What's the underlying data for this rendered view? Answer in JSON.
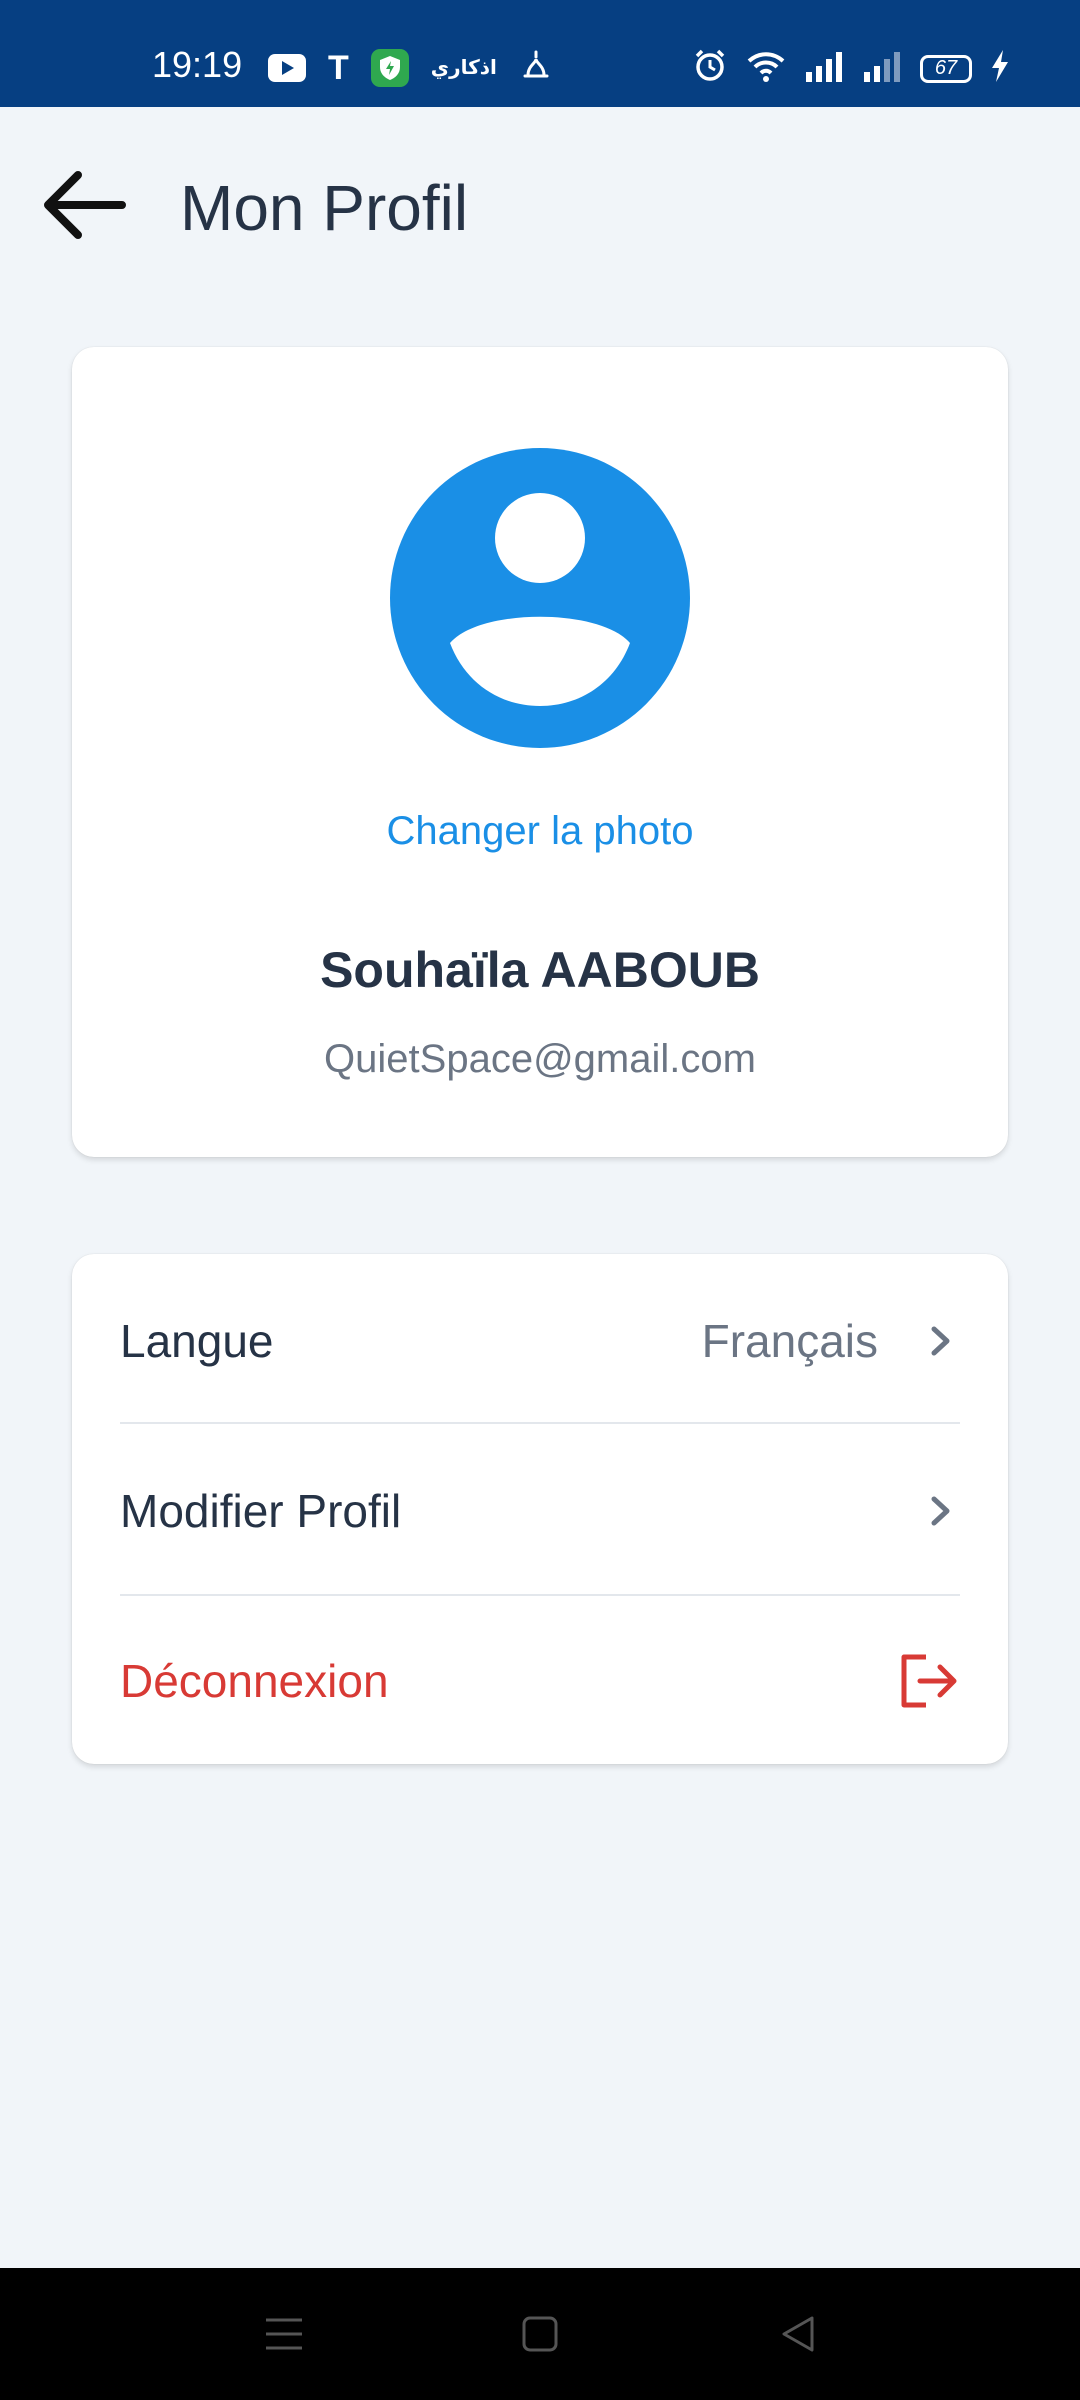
{
  "status_bar": {
    "time": "19:19",
    "app_text": "اذكاري",
    "t_letter": "T",
    "battery": "67",
    "icons": [
      "youtube-icon",
      "t-app-icon",
      "shield-app-icon",
      "azkari-app-icon",
      "mosque-icon",
      "alarm-icon",
      "wifi-icon",
      "signal-icon",
      "signal-2-icon",
      "battery-icon",
      "charging-icon"
    ]
  },
  "header": {
    "title": "Mon Profil",
    "back_icon": "arrow-left-icon"
  },
  "profile": {
    "avatar_icon": "user-avatar-icon",
    "change_photo": "Changer la photo",
    "name": "Souhaïla AABOUB",
    "email": "QuietSpace@gmail.com"
  },
  "settings": {
    "items": [
      {
        "label": "Langue",
        "value": "Français",
        "icon": "chevron-right-icon"
      },
      {
        "label": "Modifier Profil",
        "icon": "chevron-right-icon"
      },
      {
        "label": "Déconnexion",
        "icon": "logout-icon"
      }
    ]
  },
  "colors": {
    "status_bar": "#063f82",
    "background": "#f1f5f9",
    "accent": "#1a8fe6",
    "danger": "#d83a35",
    "text": "#263346",
    "muted": "#6b7584"
  },
  "nav_bar": {
    "buttons": [
      "menu-icon",
      "home-icon",
      "back-triangle-icon"
    ]
  }
}
